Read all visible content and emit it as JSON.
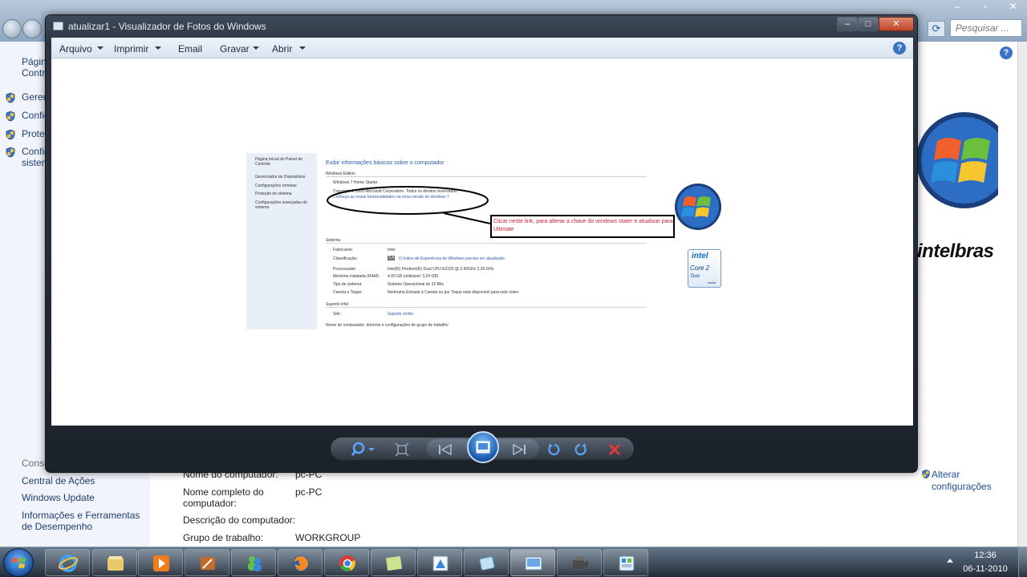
{
  "background": {
    "search_placeholder": "Pesquisar ...",
    "sidebar": {
      "top_item": "Página Inicial do Painel de Controle",
      "top_item_visible": [
        "Págin",
        "Contr"
      ],
      "items": [
        "Gerenc",
        "Config",
        "Prote",
        "Config sistem"
      ],
      "see_also_heading": "Consulte também",
      "links": [
        "Central de Ações",
        "Windows Update",
        "Informações e Ferramentas de Desempenho"
      ]
    },
    "fields": [
      {
        "label": "Nome do computador:",
        "value": "pc-PC"
      },
      {
        "label": "Nome completo do computador:",
        "value": "pc-PC"
      },
      {
        "label": "Descrição do computador:",
        "value": ""
      },
      {
        "label": "Grupo de trabalho:",
        "value": "WORKGROUP"
      }
    ],
    "change_settings": "Alterar configurações",
    "logo_text": "intelbras"
  },
  "viewer": {
    "title": "atualizar1 - Visualizador de Fotos do Windows",
    "menu": [
      "Arquivo",
      "Imprimir",
      "Email",
      "Gravar",
      "Abrir"
    ],
    "image": {
      "sidebar": [
        "Página Inicial do Painel de Controle",
        "Gerenciador de Dispositivos",
        "Configurações remotas",
        "Proteção do sistema",
        "Configurações avançadas do sistema"
      ],
      "heading": "Exibir informações básicas sobre o computador",
      "edition_heading": "Windows Edition",
      "edition_name": "Windows 7 Home Starter",
      "copyright": "Copyright © 2009 Microsoft Corporation. Todos os direitos reservados.",
      "upgrade_link": "Conheça as novas funcionalidades na nova versão do windows 7",
      "callout": "Clicar neste link, para alterar a chave do windows stater e atualizar para Ultimate",
      "system_heading": "Sistema",
      "system": [
        {
          "label": "Fabricante:",
          "value": "Intel"
        },
        {
          "label": "Classificação:",
          "value": "O Índice de Experiência do Windows precisa ser atualizado"
        },
        {
          "label": "Processador:",
          "value": "Intel(R) Pentium(R) Dual CPU  E2220  @ 2.40GHz   2.39 GHz"
        },
        {
          "label": "Memória instalada (RAM):",
          "value": "4,00 GB (utilizável: 3,24 GB)"
        },
        {
          "label": "Tipo de sistema:",
          "value": "Sistema Operacional de 32 Bits"
        },
        {
          "label": "Caneta e Toque:",
          "value": "Nenhuma Entrada à Caneta ou por Toque está disponível para este vídeo"
        }
      ],
      "score_badge": "3,4",
      "support_heading": "Suporte Intel",
      "support": {
        "label": "Site:",
        "value": "Suporte online"
      },
      "footer_heading": "Nome do computador, domínio e configurações de grupo de trabalho",
      "intel_badge": {
        "brand": "intel",
        "product": "Core 2",
        "sub": "Duo",
        "tag": "inside"
      }
    }
  },
  "taskbar": {
    "time": "12:36",
    "date": "06-11-2010"
  },
  "colors": {
    "link": "#2a5aa8",
    "callout_text": "#d0203a",
    "menu_bg": "#e2ebf5",
    "frame_dark": "#2b3440"
  }
}
